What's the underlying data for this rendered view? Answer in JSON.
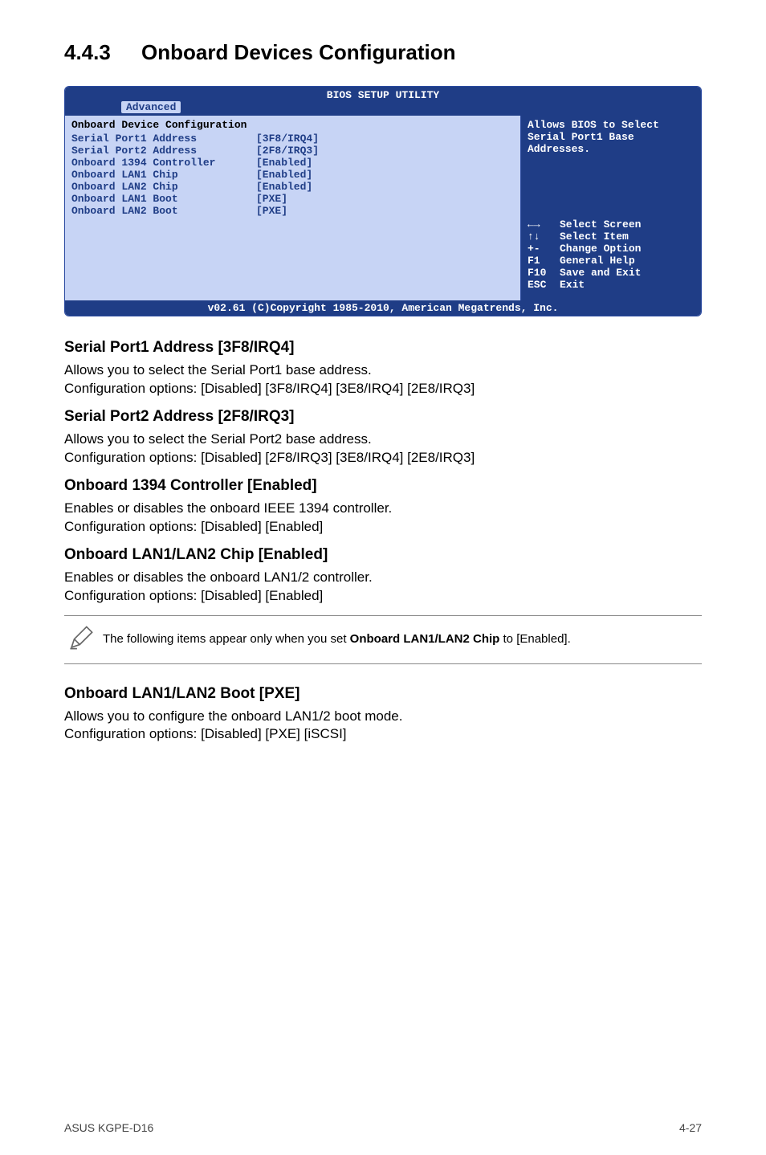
{
  "section": {
    "number": "4.4.3",
    "title": "Onboard Devices Configuration"
  },
  "bios": {
    "title": "BIOS SETUP UTILITY",
    "tab": "Advanced",
    "panel_title": "Onboard Device Configuration",
    "items": [
      {
        "key": "Serial Port1 Address",
        "val": "[3F8/IRQ4]"
      },
      {
        "key": "Serial Port2 Address",
        "val": "[2F8/IRQ3]"
      },
      {
        "key": "Onboard 1394 Controller",
        "val": "[Enabled]"
      },
      {
        "key": "Onboard LAN1 Chip",
        "val": "[Enabled]"
      },
      {
        "key": "Onboard LAN2 Chip",
        "val": "[Enabled]"
      },
      {
        "key": "Onboard LAN1 Boot",
        "val": "[PXE]"
      },
      {
        "key": "Onboard LAN2 Boot",
        "val": "[PXE]"
      }
    ],
    "help_line1": "Allows BIOS to Select",
    "help_line2": "Serial Port1 Base",
    "help_line3": "Addresses.",
    "keys": [
      {
        "kb": "←→",
        "desc": "Select Screen"
      },
      {
        "kb": "↑↓",
        "desc": "Select Item"
      },
      {
        "kb": "+-",
        "desc": "Change Option"
      },
      {
        "kb": "F1",
        "desc": "General Help"
      },
      {
        "kb": "F10",
        "desc": "Save and Exit"
      },
      {
        "kb": "ESC",
        "desc": "Exit"
      }
    ],
    "copyright": "v02.61 (C)Copyright 1985-2010, American Megatrends, Inc."
  },
  "sections": {
    "sp1": {
      "title": "Serial Port1 Address [3F8/IRQ4]",
      "l1": "Allows you to select the Serial Port1 base address.",
      "l2": "Configuration options: [Disabled] [3F8/IRQ4] [3E8/IRQ4] [2E8/IRQ3]"
    },
    "sp2": {
      "title": "Serial Port2 Address [2F8/IRQ3]",
      "l1": "Allows you to select the Serial Port2 base address.",
      "l2": "Configuration options: [Disabled] [2F8/IRQ3] [3E8/IRQ4] [2E8/IRQ3]"
    },
    "o1394": {
      "title": "Onboard 1394 Controller [Enabled]",
      "l1": "Enables or disables the onboard IEEE 1394 controller.",
      "l2": "Configuration options: [Disabled] [Enabled]"
    },
    "lanchip": {
      "title": "Onboard LAN1/LAN2 Chip [Enabled]",
      "l1": "Enables or disables the onboard LAN1/2 controller.",
      "l2": "Configuration options: [Disabled] [Enabled]"
    },
    "lanboot": {
      "title": "Onboard LAN1/LAN2 Boot [PXE]",
      "l1": "Allows you to configure the onboard LAN1/2 boot mode.",
      "l2": "Configuration options: [Disabled] [PXE] [iSCSI]"
    }
  },
  "note": {
    "pre": "The following items appear only when you set ",
    "bold": "Onboard LAN1/LAN2 Chip",
    "post": " to [Enabled]."
  },
  "footer": {
    "left": "ASUS KGPE-D16",
    "right": "4-27"
  }
}
